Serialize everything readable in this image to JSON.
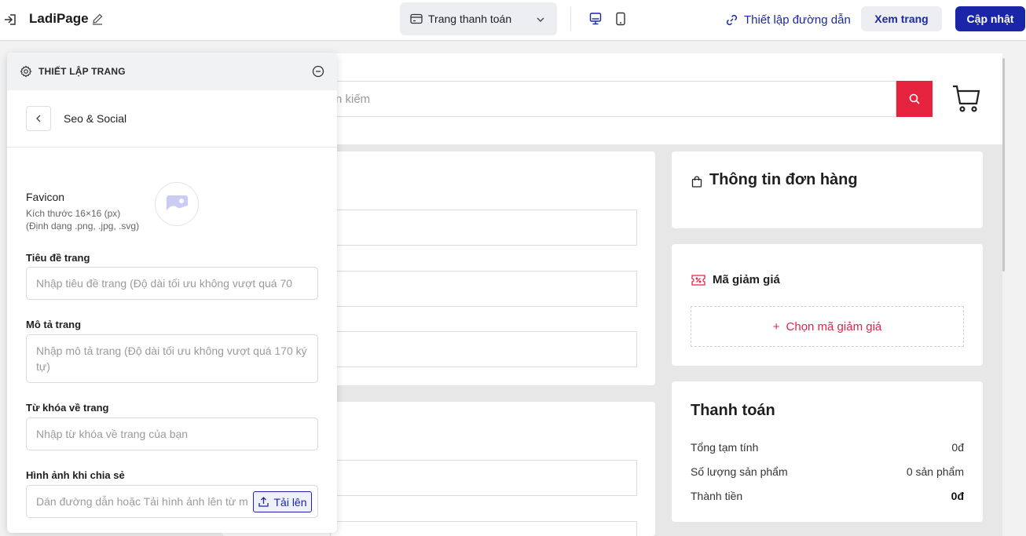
{
  "topbar": {
    "app_title": "LadiPage",
    "page_selector": "Trang thanh toán",
    "link_setup": "Thiết lập đường dẫn",
    "view_button": "Xem trang",
    "update_button": "Cập nhật"
  },
  "canvas": {
    "search_placeholder_fragment": "n kiếm",
    "order_title": "Thông tin đơn hàng",
    "coupon_title": "Mã giảm giá",
    "coupon_button": "Chọn mã giảm giá",
    "payment_title": "Thanh toán",
    "payment_rows": [
      {
        "label": "Tổng tạm tính",
        "value": "0đ"
      },
      {
        "label": "Số lượng sản phẩm",
        "value": "0 sản phẩm"
      },
      {
        "label": "Thành tiền",
        "value": "0đ"
      }
    ]
  },
  "panel": {
    "title": "THIẾT LẬP TRANG",
    "section_title": "Seo & Social",
    "favicon": {
      "label": "Favicon",
      "size": "Kích thước 16×16 (px)",
      "formats": "(Định dạng .png, .jpg, .svg)"
    },
    "page_title": {
      "label": "Tiêu đề trang",
      "placeholder": "Nhập tiêu đề trang (Độ dài tối ưu không vượt quá 70"
    },
    "page_description": {
      "label": "Mô tả trang",
      "placeholder": "Nhập mô tả trang (Độ dài tối ưu không vượt quá 170 ký tự)"
    },
    "keywords": {
      "label": "Từ khóa về trang",
      "placeholder": "Nhập từ khóa về trang của bạn"
    },
    "share_image": {
      "label": "Hình ảnh khi chia sẻ",
      "placeholder": "Dán đường dẫn hoặc Tải hình ảnh lên từ m",
      "upload_button": "Tải lên"
    }
  },
  "colors": {
    "primary": "#1a25a8",
    "accent_red": "#e5233f",
    "coupon_red": "#e0244a"
  }
}
